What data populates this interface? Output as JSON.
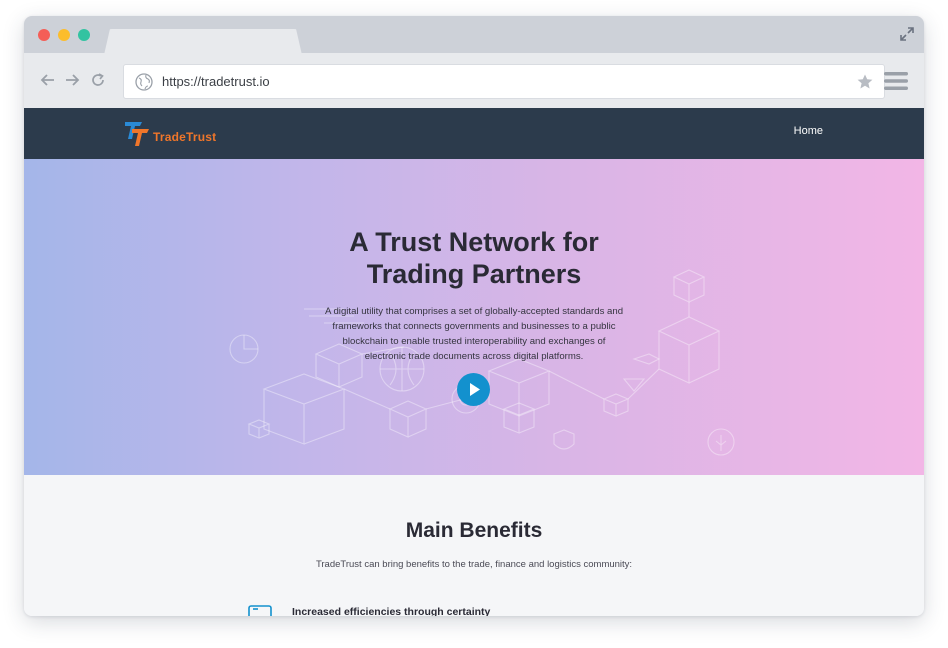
{
  "browser": {
    "url": "https://tradetrust.io",
    "icons": [
      "back-arrow-icon",
      "forward-arrow-icon",
      "reload-icon",
      "globe-icon",
      "star-icon",
      "menu-icon",
      "expand-icon"
    ],
    "traffic_lights": {
      "close": "#f45e57",
      "minimize": "#fcbd2c",
      "maximize": "#33c3a1"
    }
  },
  "site": {
    "logo_text": "TradeTrust",
    "nav": {
      "home_label": "Home"
    },
    "colors": {
      "nav_bg": "#2c3b4c",
      "logo_orange": "#f0762a",
      "logo_blue": "#2a8ad6",
      "play_blue": "#1391ce"
    }
  },
  "hero": {
    "title_line1": "A Trust Network for",
    "title_line2": "Trading Partners",
    "description": "A digital utility that comprises a set of globally-accepted standards and frameworks that connects governments and businesses to a public blockchain to enable trusted interoperability and exchanges of electronic trade documents across digital platforms.",
    "play_icon": "play-icon"
  },
  "benefits": {
    "title": "Main Benefits",
    "subtitle": "TradeTrust can bring benefits to the trade, finance and logistics community:",
    "items": [
      {
        "icon": "document-icon",
        "label": "Increased efficiencies through certainty"
      }
    ]
  }
}
